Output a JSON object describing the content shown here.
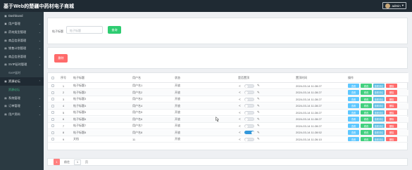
{
  "topbar": {
    "title": "基于Web的楚疆中药材电子商城",
    "user": "admin"
  },
  "sidebar": {
    "items": [
      {
        "label": "Dashboard",
        "icon": "dashboard-icon",
        "has_chevron": false,
        "active": false
      },
      {
        "label": "用户管理",
        "icon": "users-icon",
        "has_chevron": true,
        "active": false
      },
      {
        "label": "药材类型管理",
        "icon": "category-icon",
        "has_chevron": true,
        "active": false
      },
      {
        "label": "商品信息管理",
        "icon": "product-icon",
        "has_chevron": true,
        "active": false
      },
      {
        "label": "销售计划管理",
        "icon": "plan-icon",
        "has_chevron": true,
        "active": false
      },
      {
        "label": "商品信息管理",
        "icon": "product-icon",
        "has_chevron": true,
        "active": false
      },
      {
        "label": "SVIP延时管理",
        "icon": "vip-icon",
        "has_chevron": true,
        "active": false
      },
      {
        "label": "SVIP延时",
        "sub": true
      },
      {
        "label": "资源论坛",
        "icon": "forum-icon",
        "has_chevron": true,
        "active": true
      },
      {
        "label": "资源论坛",
        "sub": true,
        "active": true
      },
      {
        "label": "系统管理",
        "icon": "settings-icon",
        "has_chevron": true,
        "active": false
      },
      {
        "label": "订单管理",
        "icon": "order-icon",
        "has_chevron": true,
        "active": false
      },
      {
        "label": "用户资料",
        "icon": "profile-icon",
        "has_chevron": true,
        "active": false
      }
    ]
  },
  "search": {
    "label": "帖子标题",
    "placeholder": "帖子标题",
    "button": "查询"
  },
  "toolbar": {
    "delete_label": "删除"
  },
  "table": {
    "headers": {
      "seq": "序号",
      "title": "帖子标题",
      "user": "用户名",
      "status": "状态",
      "top": "是否置顶",
      "time": "置顶时间",
      "ops": "操作"
    },
    "op_labels": {
      "view": "查看",
      "edit": "修改",
      "comment": "查看评论",
      "delete": "删除"
    },
    "rows": [
      {
        "seq": "1",
        "title": "帖子标题1",
        "user": "用户名1",
        "status": "开放",
        "top_on": false,
        "time": "2024-03-14 11:28:27"
      },
      {
        "seq": "2",
        "title": "帖子标题2",
        "user": "用户名2",
        "status": "开放",
        "top_on": false,
        "time": "2024-03-14 11:28:27"
      },
      {
        "seq": "3",
        "title": "帖子标题3",
        "user": "用户名3",
        "status": "开放",
        "top_on": false,
        "time": "2024-03-14 11:28:27"
      },
      {
        "seq": "4",
        "title": "帖子标题4",
        "user": "用户名4",
        "status": "开放",
        "top_on": false,
        "time": "2024-03-14 11:28:27"
      },
      {
        "seq": "5",
        "title": "帖子标题5",
        "user": "用户名5",
        "status": "开放",
        "top_on": false,
        "time": "2024-03-14 11:28:27"
      },
      {
        "seq": "6",
        "title": "帖子标题6",
        "user": "用户名6",
        "status": "开放",
        "top_on": false,
        "time": "2024-03-14 11:28:27"
      },
      {
        "seq": "7",
        "title": "帖子标题7",
        "user": "用户名7",
        "status": "开放",
        "top_on": false,
        "time": "2024-03-14 11:28:27"
      },
      {
        "seq": "8",
        "title": "帖子标题8",
        "user": "用户名8",
        "status": "开放",
        "top_on": true,
        "time": "2024-03-14 11:28:52"
      },
      {
        "seq": "9",
        "title": "文档",
        "user": "11",
        "status": "开放",
        "top_on": false,
        "time": "2024-03-14 11:26:10"
      }
    ]
  },
  "pager": {
    "current": "1",
    "goto_prefix": "前往",
    "goto_value": "1",
    "goto_suffix": "页"
  },
  "colors": {
    "topbar": "#1f2a33",
    "sidebar": "#2b3a42",
    "search_btn": "#2ecc71",
    "delete_btn": "#ff6b6b",
    "toggle_on": "#3498db"
  }
}
